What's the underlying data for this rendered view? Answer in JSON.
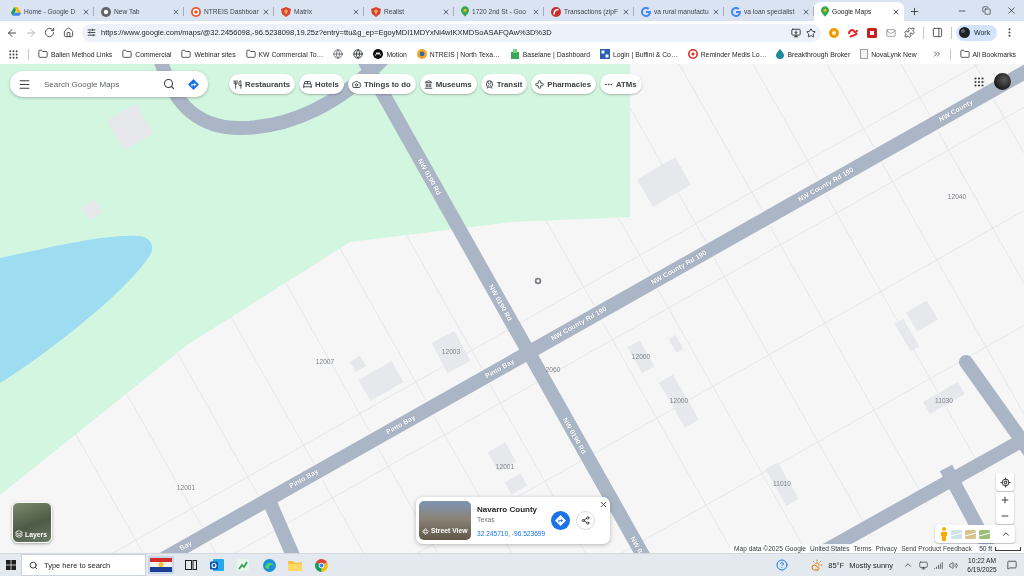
{
  "browser": {
    "tabs": [
      {
        "title": "Home - Google D",
        "selected": false
      },
      {
        "title": "New Tab",
        "selected": false
      },
      {
        "title": "NTREIS Dashboar",
        "selected": false
      },
      {
        "title": "Matrix",
        "selected": false
      },
      {
        "title": "Realist",
        "selected": false
      },
      {
        "title": "1720 2nd St - Goo",
        "selected": false
      },
      {
        "title": "Transactions (zipF",
        "selected": false
      },
      {
        "title": "va rural manufactu",
        "selected": false
      },
      {
        "title": "va loan specialist",
        "selected": false
      },
      {
        "title": "Google Maps",
        "selected": true
      }
    ],
    "nav": [
      {
        "kind": "back",
        "disabled": false
      },
      {
        "kind": "forward",
        "disabled": true
      }
    ],
    "address": "https://www.google.com/maps/@32.2456098,-96.5238098,19.25z?entry=ttu&g_ep=EgoyMDI1MDYxNi4wIKXMDSoASAFQAw%3D%3D",
    "profile": "Work",
    "bookmarks": [
      {
        "kind": "folder",
        "label": "Ballen Method Links"
      },
      {
        "kind": "folder",
        "label": "Commercial"
      },
      {
        "kind": "folder",
        "label": "Webinar sites"
      },
      {
        "kind": "folder",
        "label": "KW Commercial To…"
      },
      {
        "kind": "site"
      },
      {
        "kind": "site"
      },
      {
        "kind": "site",
        "label": "Motion"
      },
      {
        "kind": "site",
        "label": "NTREIS | North Texa…"
      },
      {
        "kind": "site",
        "label": "Baselane | Dashboard"
      },
      {
        "kind": "site",
        "label": "Login | Buffini & Co…"
      },
      {
        "kind": "site",
        "label": "Reminder Medis Lo…"
      },
      {
        "kind": "site",
        "label": "Breakthrough Broker"
      },
      {
        "kind": "site",
        "label": "NovaLynk New"
      }
    ],
    "all_bookmarks": "All Bookmarks"
  },
  "maps": {
    "search": {
      "placeholder": "Search Google Maps"
    },
    "chips": [
      {
        "label": "Restaurants"
      },
      {
        "label": "Hotels"
      },
      {
        "label": "Things to do"
      },
      {
        "label": "Museums"
      },
      {
        "label": "Transit"
      },
      {
        "label": "Pharmacies"
      },
      {
        "label": "ATMs"
      }
    ],
    "road_labels": [
      "NW County",
      "NW 0190 Rd",
      "NW County Rd 190",
      "NW County Rd 190",
      "NW 0190 Rd",
      "NW County Rd 190",
      "Pinto Bay",
      "Pinto Bay",
      "NW 0190 Rd",
      "Pinto Bay",
      "Bay",
      "NW 0"
    ],
    "house_numbers": [
      "12040",
      "12003",
      "12000",
      "12007",
      "2060",
      "12000",
      "11030",
      "12001",
      "11010",
      "12001"
    ],
    "place_card": {
      "title": "Navarro County",
      "subtitle": "Texas",
      "coordinates": "32.245710, -96.523699",
      "photo_label": "Street View"
    },
    "layers_label": "Layers",
    "footer": [
      "Map data ©2025 Google",
      "United States",
      "Terms",
      "Privacy",
      "Send Product Feedback"
    ],
    "scale": "50 ft"
  },
  "taskbar": {
    "search": {
      "placeholder": "Type here to search"
    },
    "weather": {
      "temperature": "85°F",
      "condition": "Mostly sunny"
    },
    "time": "10:22 AM",
    "date": "6/19/2025"
  }
}
